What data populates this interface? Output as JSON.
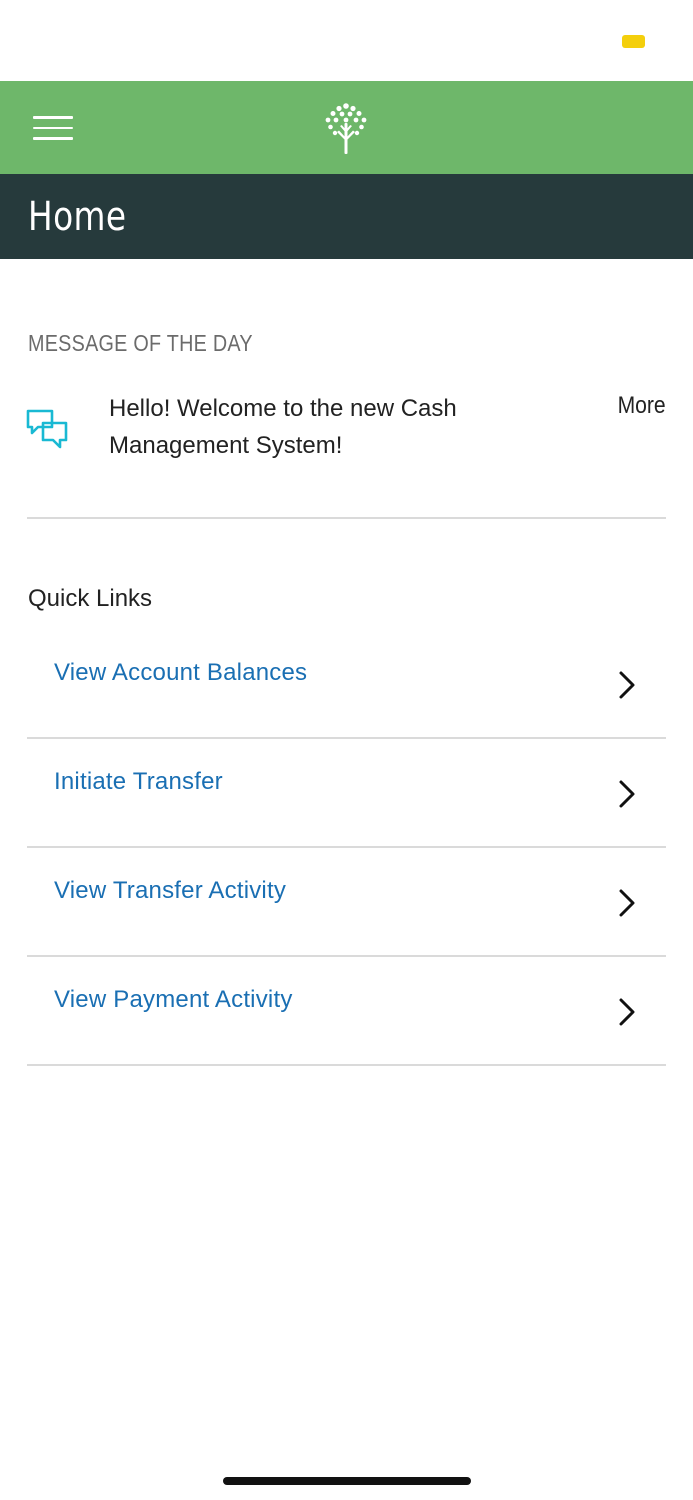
{
  "colors": {
    "header_green": "#6eb76a",
    "title_bar_dark": "#263a3c",
    "link_blue": "#1a6fb3",
    "icon_cyan": "#19b9d3",
    "status_yellow": "#f4cf0c"
  },
  "status_bar": {
    "indicator_icon": "battery-indicator-icon"
  },
  "header": {
    "menu_icon": "hamburger-menu-icon",
    "logo_icon": "tree-logo-icon"
  },
  "title_bar": {
    "title": "Home"
  },
  "message_of_the_day": {
    "heading": "MESSAGE OF THE DAY",
    "icon": "chat-bubbles-icon",
    "text": "Hello! Welcome to the new Cash Management System!",
    "more_label": "More"
  },
  "quick_links": {
    "heading": "Quick Links",
    "items": [
      {
        "label": "View Account Balances",
        "icon": "chevron-right-icon"
      },
      {
        "label": "Initiate Transfer",
        "icon": "chevron-right-icon"
      },
      {
        "label": "View Transfer Activity",
        "icon": "chevron-right-icon"
      },
      {
        "label": "View Payment Activity",
        "icon": "chevron-right-icon"
      }
    ]
  }
}
